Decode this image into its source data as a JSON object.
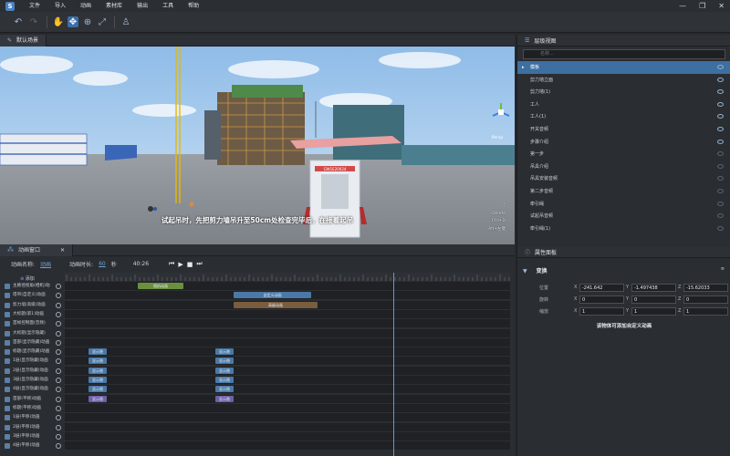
{
  "menu": [
    "文件",
    "导入",
    "动画",
    "素材库",
    "输出",
    "工具",
    "帮助"
  ],
  "window_controls": [
    "—",
    "❐",
    "✕"
  ],
  "viewport": {
    "tab": "默认场景",
    "subtitle": "试起吊时，先把剪力墙吊升至50cm处检查完毕后，在接着起吊",
    "keys": [
      "F",
      "Delete",
      "Ctrl+D",
      "Alt+左键"
    ],
    "view_label": "Persp",
    "sign_text": "GW1E20024"
  },
  "anim": {
    "tab": "动画窗口",
    "name_label": "动画名称:",
    "name_value": "动画",
    "duration_label": "动画时长:",
    "duration_value": "60",
    "duration_unit": "秒",
    "time": "40:26",
    "add_label": "添加",
    "rows": [
      "主路径视角(相机)动画",
      "塔吊(自定义)动画",
      "剪力墙(高级)动画",
      "大标题(第1)动画",
      "首帧控制面(音频)",
      "大标题(显示隐藏)",
      "首部(显示隐藏)动画",
      "标题(显示隐藏)动画",
      "1层(显示隐藏)动画",
      "2层(显示隐藏)动画",
      "3层(显示隐藏)动画",
      "4层(显示隐藏)动画",
      "首部(平移)动画",
      "标题(平移)动画",
      "1层(平移)动画",
      "2层(平移)动画",
      "3层(平移)动画",
      "4层(平移)动画"
    ],
    "clips": {
      "camera": "相机动画",
      "custom": "自定义动画",
      "advanced": "高级动画",
      "show": "显示隐"
    }
  },
  "layers": {
    "title": "层级视图",
    "search_placeholder": "名称...",
    "items": [
      "模板",
      "剪力墙立面",
      "剪力墙(1)",
      "工人",
      "工人(1)",
      "开关音频",
      "步骤介绍",
      "第一步",
      "吊具介绍",
      "吊具安装音频",
      "第二步音频",
      "牵引绳",
      "试起吊音频",
      "牵引绳(1)"
    ]
  },
  "props": {
    "title": "属性面板",
    "section": "变换",
    "position_label": "位置",
    "rotation_label": "旋转",
    "scale_label": "缩放",
    "position": [
      "-241.642",
      "-1.497438",
      "-15.62033"
    ],
    "rotation": [
      "0",
      "0",
      "0"
    ],
    "scale": [
      "1",
      "1",
      "1"
    ],
    "note": "该物体可添加自定义动画"
  },
  "colors": {
    "accent": "#3d6fa0",
    "sky": "#a9cdf0",
    "ground": "#8c9196",
    "clip_blue": "#4a79a8",
    "clip_purple": "#6f5fa8",
    "clip_green": "#6a8f3e"
  }
}
